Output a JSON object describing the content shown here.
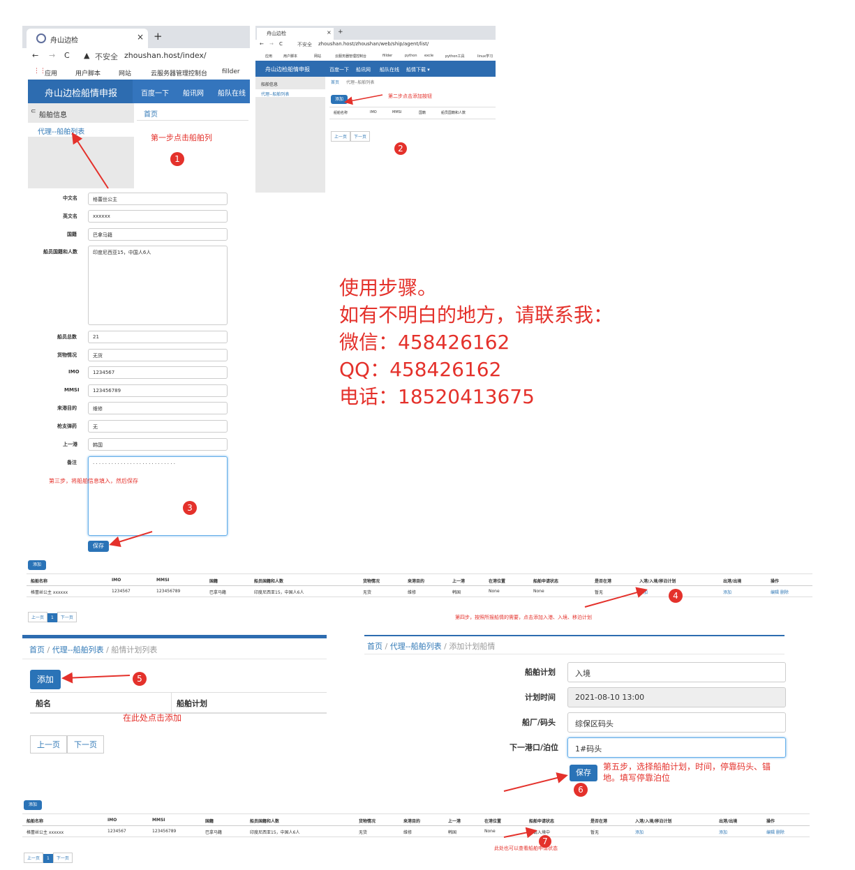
{
  "browser1": {
    "tab_title": "舟山边检",
    "url_insecure": "不安全",
    "url": "zhoushan.host/index/",
    "bookmarks": [
      "应用",
      "用户脚本",
      "网站",
      "云服务器管理控制台",
      "fillder"
    ]
  },
  "app1": {
    "brand": "舟山边检船情申报",
    "nav": [
      "百度一下",
      "船讯网",
      "船队在线"
    ],
    "sidebar_header": "船舶信息",
    "sidebar_item": "代理--船舶列表",
    "breadcrumb": "首页",
    "step1": "第一步点击船舶列",
    "badge": "1"
  },
  "browser2": {
    "tab_title": "舟山边检",
    "url_insecure": "不安全",
    "url": "zhoushan.host/zhoushan/web/ship/agent/list/",
    "bookmarks": [
      "应用",
      "用户脚本",
      "网站",
      "云服务器管理控制台",
      "fillder",
      "python",
      "excle",
      "python工具",
      "linux学习"
    ]
  },
  "app2": {
    "brand": "舟山边检船情申报",
    "nav": [
      "百度一下",
      "船讯网",
      "船队在线",
      "船情下载 ▾"
    ],
    "sidebar_header": "船舶信息",
    "sidebar_item": "代理--船舶列表",
    "breadcrumb_home": "首页",
    "breadcrumb_current": "代理--船舶列表",
    "add": "添加",
    "step2": "第二步点击添加按钮",
    "columns": [
      "船舶名称",
      "IMO",
      "MMSI",
      "国籍",
      "船员国籍和人数"
    ],
    "prev": "上一页",
    "next": "下一页",
    "badge": "2"
  },
  "form": {
    "fields": [
      {
        "label": "中文名",
        "value": "格蕾丝公主"
      },
      {
        "label": "英文名",
        "value": "xxxxxx"
      },
      {
        "label": "国籍",
        "value": "巴拿马籍"
      },
      {
        "label": "船员国籍和人数",
        "value": "印度尼西亚15，中国人6人"
      },
      {
        "label": "船员总数",
        "value": "21"
      },
      {
        "label": "货物情况",
        "value": "无货"
      },
      {
        "label": "IMO",
        "value": "1234567"
      },
      {
        "label": "MMSI",
        "value": "123456789"
      },
      {
        "label": "来港目的",
        "value": "维修"
      },
      {
        "label": "枪支弹药",
        "value": "无"
      },
      {
        "label": "上一港",
        "value": "韩国"
      },
      {
        "label": "备注",
        "value": ". . . . . . . . . . . . . . . . . . . . . . . . . . ."
      }
    ],
    "step3": "第三步，将船舶信息填入，然后保存",
    "save": "保存",
    "badge": "3"
  },
  "instructions": {
    "lines": [
      "使用步骤。",
      "如有不明白的地方，请联系我：",
      "微信：458426162",
      "QQ：458426162",
      "电话：18520413675"
    ]
  },
  "list1": {
    "add": "添加",
    "columns": [
      "船舶名称",
      "IMO",
      "MMSI",
      "国籍",
      "船员国籍和人数",
      "货物情况",
      "来港目的",
      "上一港",
      "在港位置",
      "船舶申请状态",
      "是否在港",
      "入港/入境/移泊计划",
      "出港/出境",
      "操作"
    ],
    "row": [
      "格蕾丝公主 xxxxxx",
      "1234567",
      "123456789",
      "巴拿马籍",
      "印度尼西亚15，中国人6人",
      "无货",
      "维修",
      "韩国",
      "None",
      "None",
      "暂无",
      "添加",
      "添加",
      "编辑 删除"
    ],
    "pages": [
      "上一页",
      "1",
      "下一页"
    ],
    "step4": "第四步，按照所报船情的需要，点击添加入港、入境、移泊计划",
    "badge": "4"
  },
  "plan_list": {
    "breadcrumb": [
      "首页",
      "代理--船舶列表",
      "船情计划列表"
    ],
    "add": "添加",
    "columns": [
      "船名",
      "船舶计划"
    ],
    "hint": "在此处点击添加",
    "prev": "上一页",
    "next": "下一页",
    "badge": "5"
  },
  "plan_form": {
    "breadcrumb": [
      "首页",
      "代理--船舶列表",
      "添加计划船情"
    ],
    "fields": [
      {
        "label": "船舶计划",
        "value": "入境"
      },
      {
        "label": "计划时间",
        "value": "2021-08-10 13:00"
      },
      {
        "label": "船厂/码头",
        "value": "综保区码头"
      },
      {
        "label": "下一港口/泊位",
        "value": "1#码头"
      }
    ],
    "save": "保存",
    "step5_line1": "第五步，选择船舶计划，时间，停靠码头、锚",
    "step5_line2": "地。填写停靠泊位",
    "badge": "6"
  },
  "list2": {
    "add": "添加",
    "columns": [
      "船舶名称",
      "IMO",
      "MMSI",
      "国籍",
      "船员国籍和人数",
      "货物情况",
      "来港目的",
      "上一港",
      "在港位置",
      "船舶申请状态",
      "是否在港",
      "入港/入境/移泊计划",
      "出港/出境",
      "操作"
    ],
    "row": [
      "格蕾丝公主 xxxxxx",
      "1234567",
      "123456789",
      "巴拿马籍",
      "印度尼西亚15，中国人6人",
      "无货",
      "维修",
      "韩国",
      "None",
      "审请入境中",
      "暂无",
      "添加",
      "添加",
      "编辑 删除"
    ],
    "pages": [
      "上一页",
      "1",
      "下一页"
    ],
    "note": "此处也可以查看船舶申请状态",
    "badge": "7"
  }
}
